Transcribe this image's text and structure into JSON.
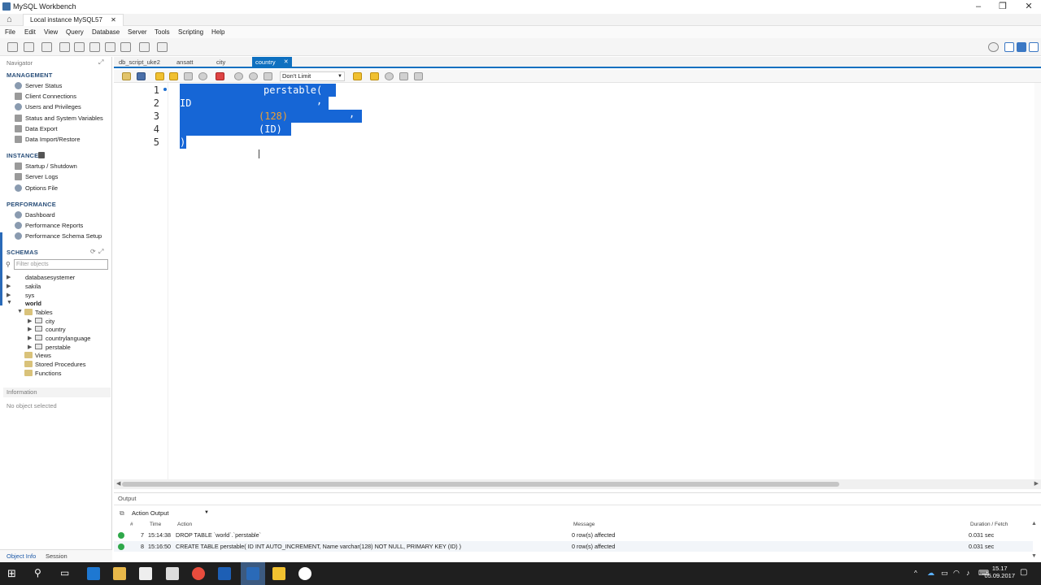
{
  "window": {
    "title": "MySQL Workbench",
    "connection_tab": "Local instance MySQL57"
  },
  "menu": [
    "File",
    "Edit",
    "View",
    "Query",
    "Database",
    "Server",
    "Tools",
    "Scripting",
    "Help"
  ],
  "navigator": {
    "title": "Navigator",
    "management": {
      "title": "MANAGEMENT",
      "items": [
        "Server Status",
        "Client Connections",
        "Users and Privileges",
        "Status and System Variables",
        "Data Export",
        "Data Import/Restore"
      ]
    },
    "instance": {
      "title": "INSTANCE",
      "items": [
        "Startup / Shutdown",
        "Server Logs",
        "Options File"
      ]
    },
    "performance": {
      "title": "PERFORMANCE",
      "items": [
        "Dashboard",
        "Performance Reports",
        "Performance Schema Setup"
      ]
    },
    "schemas": {
      "title": "SCHEMAS",
      "filter_placeholder": "Filter objects",
      "list": [
        "databasesystemer",
        "sakila",
        "sys",
        "world"
      ],
      "world_children": {
        "tables_label": "Tables",
        "tables": [
          "city",
          "country",
          "countrylanguage",
          "perstable"
        ],
        "views": "Views",
        "procedures": "Stored Procedures",
        "functions": "Functions"
      }
    },
    "information": {
      "title": "Information",
      "empty": "No object selected"
    },
    "bottom_tabs": [
      "Object Info",
      "Session"
    ]
  },
  "editor": {
    "tabs": [
      "db_script_uke2",
      "ansatt",
      "city",
      "country"
    ],
    "active_tab": "country",
    "limit": "Don't Limit",
    "line_numbers": [
      "1",
      "2",
      "3",
      "4",
      "5"
    ],
    "lines": {
      "l1": "perstable(",
      "l2": "ID",
      "l2b": ",",
      "l3": "(128)",
      "l3b": ",",
      "l4": "(ID)",
      "l5": ")"
    }
  },
  "output": {
    "title": "Output",
    "selector": "Action Output",
    "headers": {
      "num": "#",
      "time": "Time",
      "action": "Action",
      "message": "Message",
      "duration": "Duration / Fetch"
    },
    "rows": [
      {
        "num": "7",
        "time": "15:14:38",
        "action": "DROP TABLE `world`.`perstable`",
        "message": "0 row(s) affected",
        "duration": "0.031 sec"
      },
      {
        "num": "8",
        "time": "15:16:50",
        "action": "CREATE TABLE perstable( ID INT AUTO_INCREMENT, Name varchar(128) NOT NULL, PRIMARY KEY (ID) )",
        "message": "0 row(s) affected",
        "duration": "0.031 sec"
      }
    ]
  },
  "taskbar": {
    "time": "15.17",
    "date": "05.09.2017"
  },
  "colors": {
    "accent": "#0e70c0",
    "selection": "#1666d6",
    "number": "#f0a030"
  }
}
